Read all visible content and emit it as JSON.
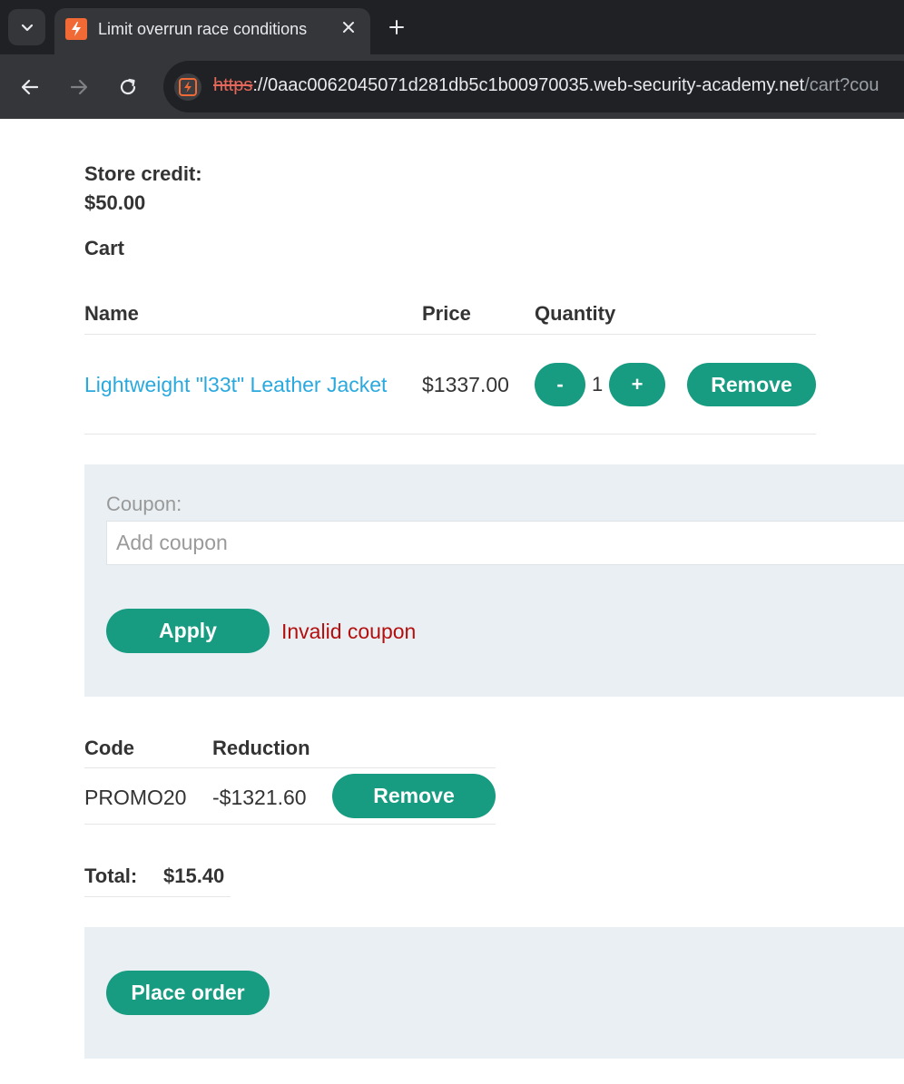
{
  "browser": {
    "tab_title": "Limit overrun race conditions",
    "url_scheme": "https",
    "url_host": "://0aac0062045071d281db5c1b00970035.web-security-academy.net",
    "url_path": "/cart?cou"
  },
  "store_credit": {
    "label": "Store credit:",
    "value": "$50.00"
  },
  "cart": {
    "heading": "Cart",
    "columns": {
      "name": "Name",
      "price": "Price",
      "quantity": "Quantity"
    },
    "items": [
      {
        "name": "Lightweight \"l33t\" Leather Jacket",
        "price": "$1337.00",
        "quantity": "1",
        "minus_label": "-",
        "plus_label": "+",
        "remove_label": "Remove"
      }
    ]
  },
  "coupon": {
    "label": "Coupon:",
    "placeholder": "Add coupon",
    "apply_label": "Apply",
    "error": "Invalid coupon"
  },
  "applied_coupons": {
    "columns": {
      "code": "Code",
      "reduction": "Reduction"
    },
    "rows": [
      {
        "code": "PROMO20",
        "reduction": "-$1321.60",
        "remove_label": "Remove"
      }
    ]
  },
  "total": {
    "label": "Total:",
    "value": "$15.40"
  },
  "place_order_label": "Place order",
  "colors": {
    "button": "#179b81",
    "link": "#2aa9de",
    "error": "#b40f0f",
    "panel": "#e9eff2"
  }
}
